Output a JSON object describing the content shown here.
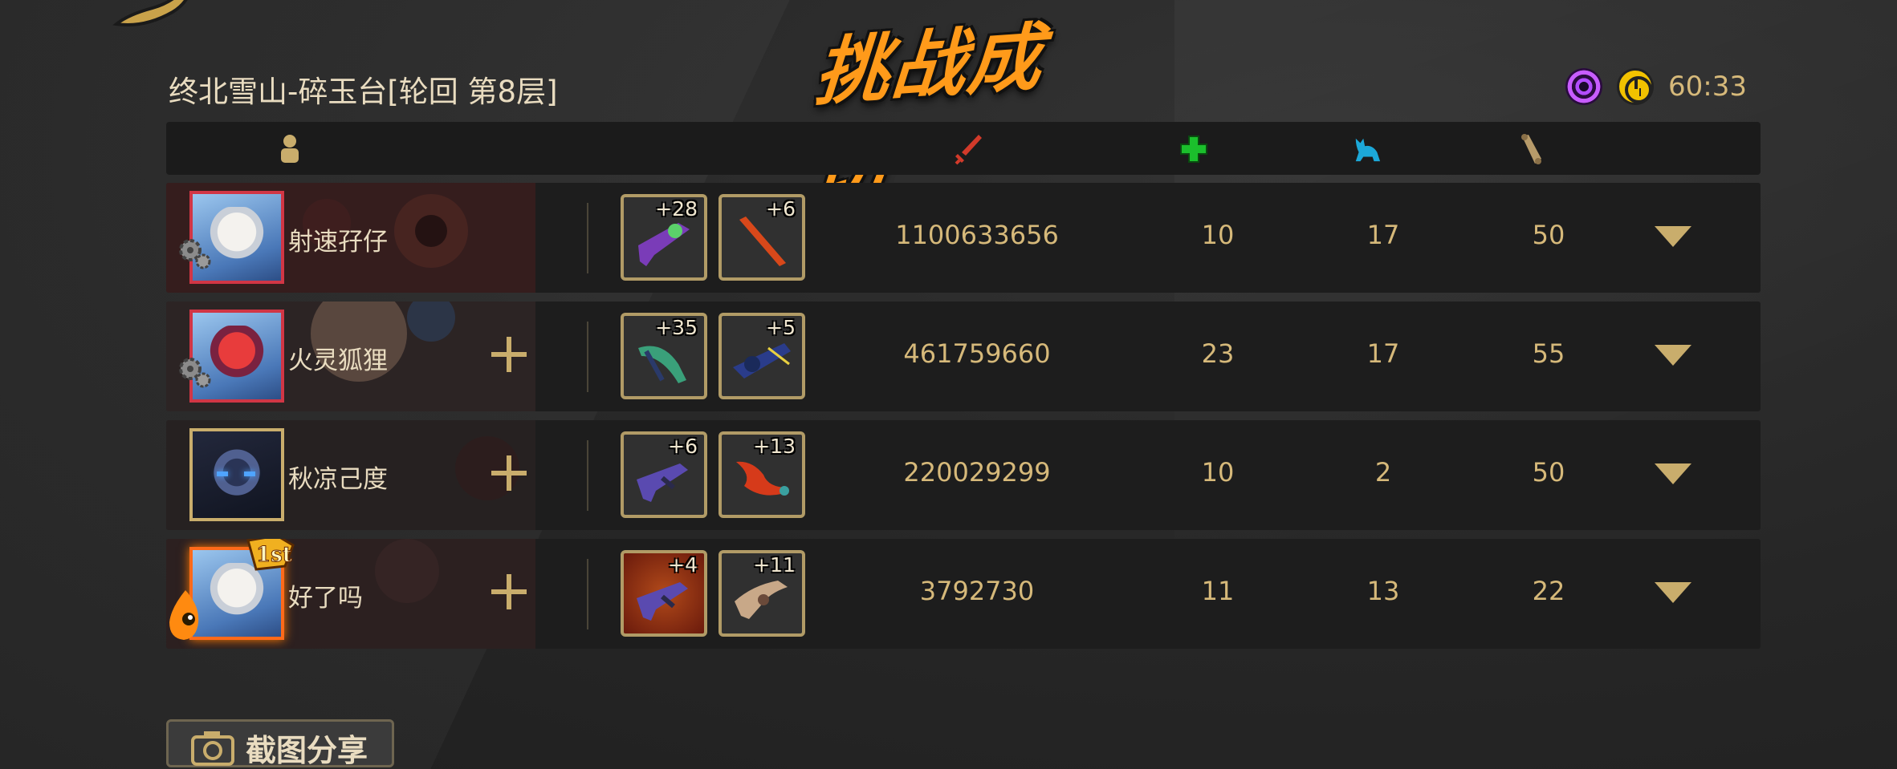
{
  "banner": {
    "title": "挑战成功"
  },
  "location": {
    "text": "终北雪山-碎玉台[轮回  第8层]"
  },
  "timer": {
    "value": "60:33"
  },
  "columns": {
    "player_icon": "person-icon",
    "damage_icon": "sword-icon",
    "heal_icon": "green-cross-icon",
    "pet_icon": "cat-icon",
    "scroll_icon": "scroll-icon"
  },
  "players": [
    {
      "name": "射速孖仔",
      "weapons": [
        {
          "level": "+28"
        },
        {
          "level": "+6"
        }
      ],
      "damage": "1100633656",
      "heal": "10",
      "pet": "17",
      "scroll": "50"
    },
    {
      "name": "火灵狐狸",
      "weapons": [
        {
          "level": "+35"
        },
        {
          "level": "+5"
        }
      ],
      "damage": "461759660",
      "heal": "23",
      "pet": "17",
      "scroll": "55"
    },
    {
      "name": "秋凉己度",
      "weapons": [
        {
          "level": "+6"
        },
        {
          "level": "+13"
        }
      ],
      "damage": "220029299",
      "heal": "10",
      "pet": "2",
      "scroll": "50"
    },
    {
      "name": "好了吗",
      "weapons": [
        {
          "level": "+4"
        },
        {
          "level": "+11"
        }
      ],
      "damage": "3792730",
      "heal": "11",
      "pet": "13",
      "scroll": "22"
    }
  ],
  "share": {
    "label": "截图分享"
  },
  "colors": {
    "gold": "#d6b97a",
    "banner_orange": "#ff9a1a",
    "avatar_border_red": "#d13645"
  }
}
